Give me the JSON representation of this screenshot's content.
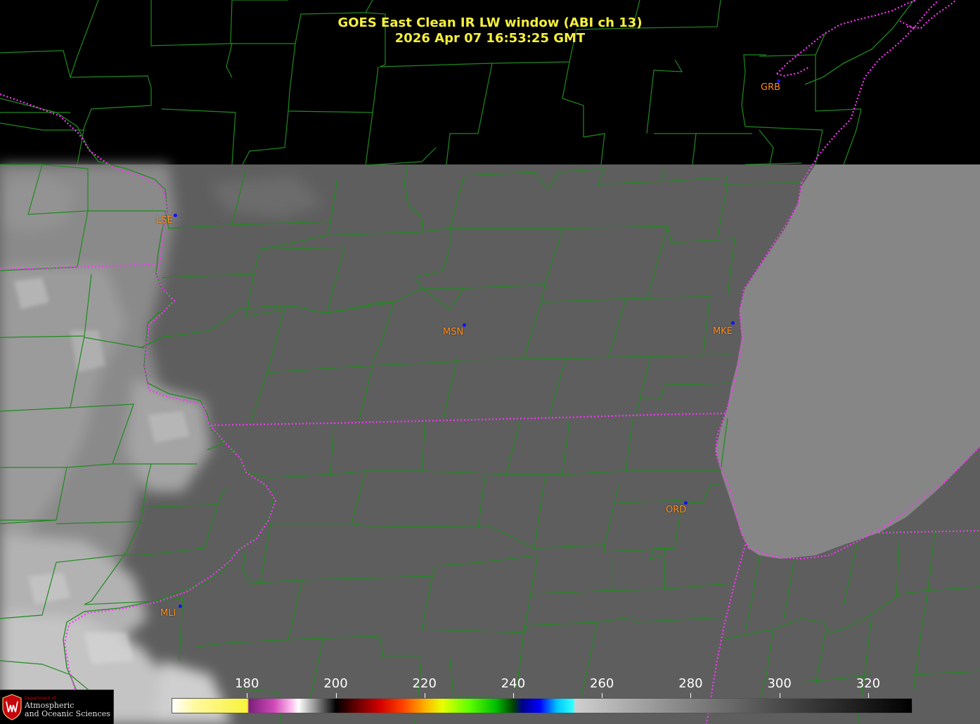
{
  "title": {
    "line1": "GOES East Clean IR LW window (ABI ch 13)",
    "line2": "2026 Apr 07  16:53:25 GMT"
  },
  "colors": {
    "title_text": "#f5f03a",
    "county_lines": "#1f8a1f",
    "state_lines": "#ff33ff",
    "city_label": "#ff8c1a",
    "city_dot": "#1010ff",
    "no_data": "#000000",
    "land_gray": "#5f5f5f",
    "lake_gray": "#868686"
  },
  "cities": [
    {
      "id": "GRB",
      "label": "GRB"
    },
    {
      "id": "LSE",
      "label": "LSE"
    },
    {
      "id": "MSN",
      "label": "MSN"
    },
    {
      "id": "MKE",
      "label": "MKE"
    },
    {
      "id": "ORD",
      "label": "ORD"
    },
    {
      "id": "MLI",
      "label": "MLI"
    }
  ],
  "colorbar": {
    "ticks": [
      "180",
      "200",
      "220",
      "240",
      "260",
      "280",
      "300",
      "320"
    ],
    "range_k": [
      163,
      330
    ]
  },
  "logo": {
    "dept": "Department of",
    "line1": "Atmospheric",
    "line2": "and Oceanic Sciences"
  }
}
